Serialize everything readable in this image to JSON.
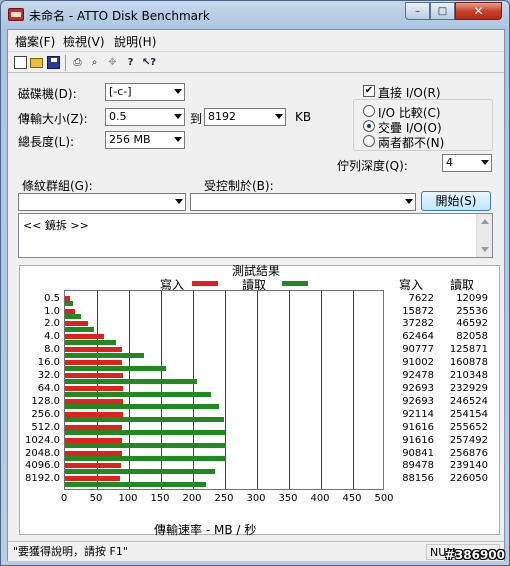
{
  "window": {
    "title": "未命名 - ATTO Disk Benchmark",
    "min": "–",
    "max": "□",
    "close": "✕"
  },
  "menu": [
    "檔案(F)",
    "檢視(V)",
    "說明(H)"
  ],
  "toolbar": {
    "new": "",
    "open": "",
    "save": "",
    "print": "⎙",
    "preview": "⌕",
    "move": "✥",
    "help": "?",
    "context_help": "↖?"
  },
  "form": {
    "drive_label": "磁碟機(D):",
    "drive_value": "[-c-]",
    "transfer_label": "傳輸大小(Z):",
    "transfer_from": "0.5",
    "to_label": "到",
    "transfer_to": "8192",
    "unit": "KB",
    "length_label": "總長度(L):",
    "length_value": "256 MB",
    "direct_io_label": "直接 I/O(R)",
    "direct_io_checked": "✔",
    "io_compare_label": "I/O 比較(C)",
    "overlapped_io_label": "交疊 I/O(O)",
    "neither_label": "兩者都不(N)",
    "queue_label": "佇列深度(Q):",
    "queue_value": "4",
    "pattern_label": "條紋群組(G):",
    "pattern_value": "",
    "controlled_label": "受控制於(B):",
    "controlled_value": "",
    "start_button": "開始(S)",
    "notes": "<< 鏡拆 >>"
  },
  "results": {
    "title": "測試結果",
    "write_label": "寫入",
    "read_label": "讀取",
    "col_write": "寫入",
    "col_read": "讀取",
    "xlabel": "傳輸速率 - MB / 秒",
    "colors": {
      "write": "#e32020",
      "read": "#1f8a1f"
    }
  },
  "chart_data": {
    "type": "bar",
    "title": "測試結果",
    "xlabel": "傳輸速率 - MB / 秒",
    "xlim": [
      0,
      500
    ],
    "x_ticks": [
      "0",
      "50",
      "100",
      "150",
      "200",
      "250",
      "300",
      "350",
      "400",
      "450",
      "500"
    ],
    "categories": [
      "0.5",
      "1.0",
      "2.0",
      "4.0",
      "8.0",
      "16.0",
      "32.0",
      "64.0",
      "128.0",
      "256.0",
      "512.0",
      "1024.0",
      "2048.0",
      "4096.0",
      "8192.0"
    ],
    "series": [
      {
        "name": "寫入",
        "values": [
          7.4,
          15.5,
          36.4,
          61.0,
          88.7,
          88.9,
          90.3,
          90.5,
          90.5,
          90.0,
          89.5,
          89.5,
          88.7,
          87.4,
          86.1
        ]
      },
      {
        "name": "讀取",
        "values": [
          11.8,
          24.9,
          45.4,
          80.1,
          122.9,
          157.1,
          205.5,
          227.8,
          240.5,
          248.2,
          249.6,
          251.4,
          250.9,
          233.8,
          220.8
        ]
      }
    ],
    "write_kb": [
      "7622",
      "15872",
      "37282",
      "62464",
      "90777",
      "91002",
      "92478",
      "92693",
      "92693",
      "92114",
      "91616",
      "91616",
      "90841",
      "89478",
      "88156"
    ],
    "read_kb": [
      "12099",
      "25536",
      "46592",
      "82058",
      "125871",
      "160878",
      "210348",
      "232929",
      "246524",
      "254154",
      "255652",
      "257492",
      "256876",
      "239140",
      "226050"
    ]
  },
  "status": {
    "help_text": "\"要獲得說明，請按 F1\"",
    "num": "NUM",
    "watermark": "#386900"
  }
}
